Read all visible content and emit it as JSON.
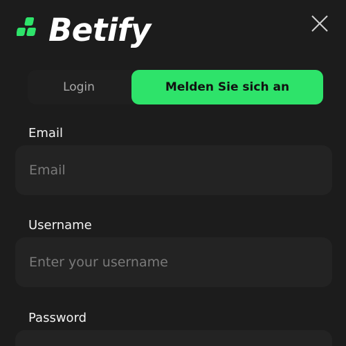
{
  "header": {
    "brand": "Betify",
    "brand_color": "#2ee36a",
    "logo_icon": "three-green-blocks-logo-icon",
    "close_icon": "close-icon"
  },
  "tabs": [
    {
      "label": "Login",
      "active": false
    },
    {
      "label": "Melden Sie sich an",
      "active": true
    }
  ],
  "form": {
    "email": {
      "label": "Email",
      "placeholder": "Email",
      "value": ""
    },
    "username": {
      "label": "Username",
      "placeholder": "Enter your username",
      "value": ""
    },
    "password": {
      "label": "Password",
      "placeholder": "",
      "value": ""
    }
  },
  "colors": {
    "background": "#1c1c1c",
    "field_background": "#232323",
    "accent": "#2ee36a",
    "placeholder": "#7a7a7a"
  }
}
